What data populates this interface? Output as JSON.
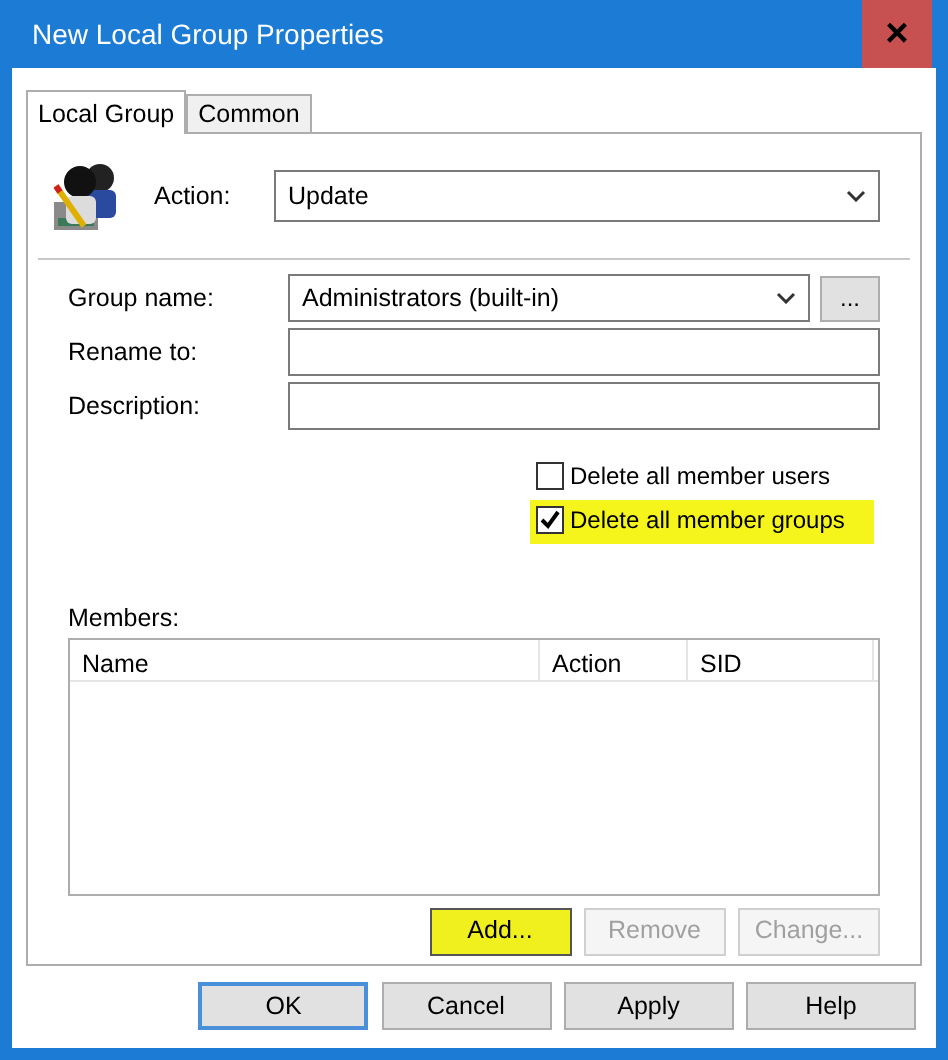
{
  "window": {
    "title": "New Local Group Properties",
    "close": "×"
  },
  "tabs": [
    {
      "label": "Local Group",
      "selected": true
    },
    {
      "label": "Common",
      "selected": false
    }
  ],
  "action": {
    "label": "Action:",
    "value": "Update"
  },
  "fields": [
    {
      "kind": "combo",
      "label": "Group name:",
      "value": "Administrators (built-in)",
      "browse": "..."
    },
    {
      "kind": "text",
      "label": "Rename to:"
    },
    {
      "kind": "text",
      "label": "Description:"
    }
  ],
  "checkboxes": [
    {
      "label": "Delete all member users",
      "checked": false,
      "highlighted": false
    },
    {
      "label": "Delete all member groups",
      "checked": true,
      "highlighted": true
    }
  ],
  "members": {
    "label": "Members:",
    "columns": [
      "Name",
      "Action",
      "SID"
    ]
  },
  "member_buttons": [
    {
      "label": "Add...",
      "disabled": false,
      "highlighted": true
    },
    {
      "label": "Remove",
      "disabled": true,
      "highlighted": false
    },
    {
      "label": "Change...",
      "disabled": true,
      "highlighted": false
    }
  ],
  "buttons": [
    {
      "label": "OK",
      "default": true
    },
    {
      "label": "Cancel",
      "default": false
    },
    {
      "label": "Apply",
      "default": false
    },
    {
      "label": "Help",
      "default": false
    }
  ]
}
